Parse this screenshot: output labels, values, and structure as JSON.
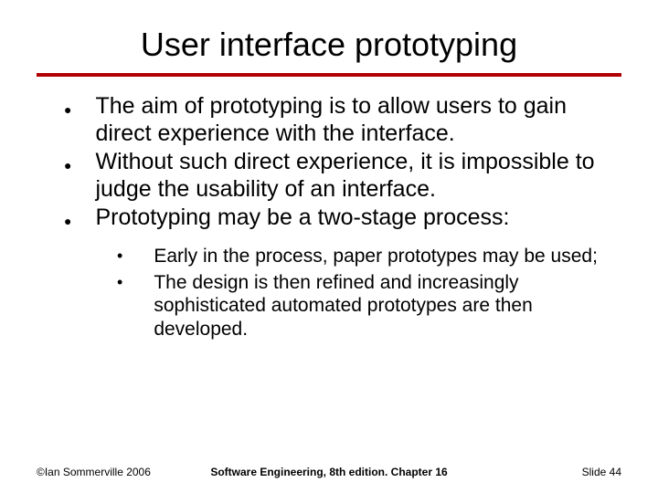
{
  "title": "User interface prototyping",
  "bullets": [
    "The aim of prototyping is to allow users to gain direct experience with the interface.",
    "Without such direct experience, it is impossible to judge the usability of an interface.",
    "Prototyping may be a two-stage process:"
  ],
  "sub_bullets": [
    "Early in the process, paper prototypes may be used;",
    "The design is then refined and increasingly sophisticated automated prototypes are then developed."
  ],
  "footer": {
    "left": "©Ian Sommerville 2006",
    "center": "Software Engineering, 8th edition. Chapter 16",
    "right": "Slide 44"
  }
}
